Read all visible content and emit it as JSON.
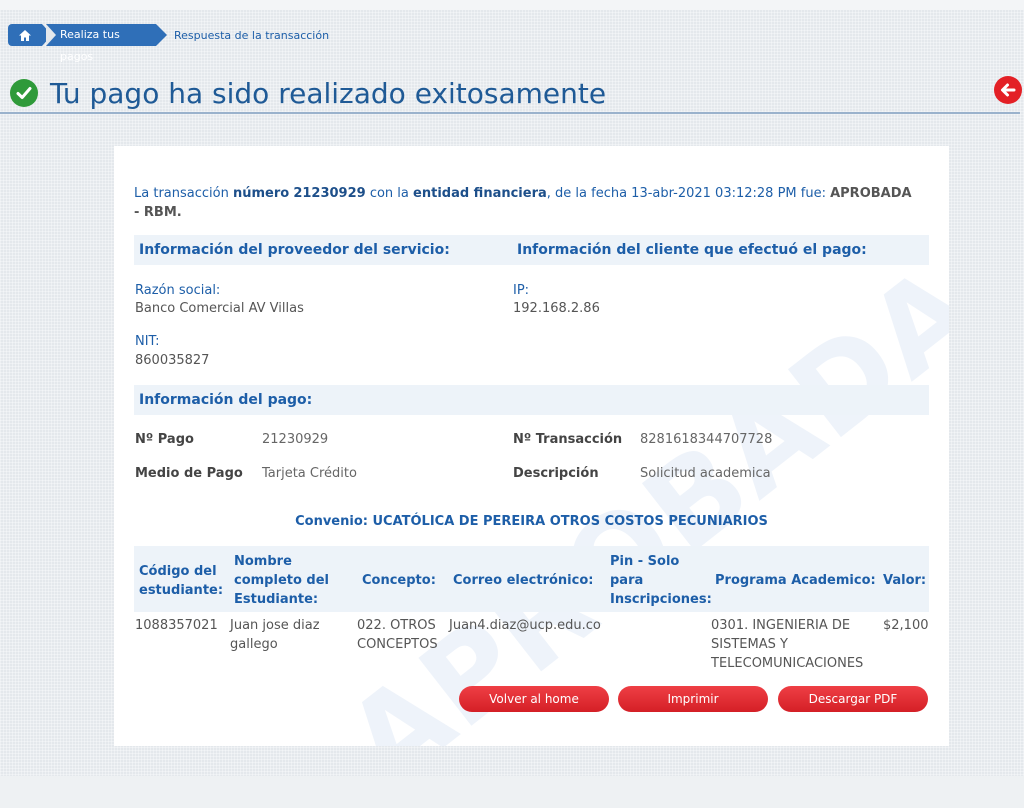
{
  "breadcrumb": {
    "item1": "Realiza tus pagos",
    "item2": "Respuesta de la transacción"
  },
  "header": {
    "title": "Tu pago ha sido realizado exitosamente"
  },
  "watermark": "APROBADA",
  "transaction": {
    "part1": "La transacción ",
    "numero_label": "número",
    "numero": "21230929",
    "part2": " con la ",
    "entidad_label": "entidad financiera",
    "part3": ", de la fecha 13-abr-2021 03:12:28 PM fue: ",
    "status": "APROBADA - RBM."
  },
  "provider": {
    "section_title": "Información del proveedor del servicio:",
    "razon_label": "Razón social:",
    "razon_value": "Banco Comercial AV Villas",
    "nit_label": "NIT:",
    "nit_value": "860035827"
  },
  "client": {
    "section_title": "Información del cliente que efectuó el pago:",
    "ip_label": "IP:",
    "ip_value": "192.168.2.86"
  },
  "payment": {
    "section_title": "Información del pago:",
    "pago_label": "Nº Pago",
    "pago_value": "21230929",
    "transaccion_label": "Nº Transacción",
    "transaccion_value": "8281618344707728",
    "medio_label": "Medio de Pago",
    "medio_value": "Tarjeta Crédito",
    "descripcion_label": "Descripción",
    "descripcion_value": "Solicitud academica"
  },
  "convenio": "Convenio: UCATÓLICA DE PEREIRA OTROS COSTOS PECUNIARIOS",
  "table": {
    "headers": {
      "codigo": [
        "Código del",
        "estudiante:"
      ],
      "nombre": [
        "Nombre",
        "completo del",
        "Estudiante:"
      ],
      "concepto": "Concepto:",
      "correo": "Correo electrónico:",
      "pin": [
        "Pin - Solo",
        "para",
        "Inscripciones:"
      ],
      "programa": "Programa Academico:",
      "valor": "Valor:"
    },
    "row": {
      "codigo": "1088357021",
      "nombre": [
        "Juan jose diaz",
        "gallego"
      ],
      "concepto": [
        "022. OTROS",
        "CONCEPTOS"
      ],
      "correo": "Juan4.diaz@ucp.edu.co",
      "pin": "",
      "programa": [
        "0301. INGENIERIA DE",
        "SISTEMAS Y",
        "TELECOMUNICACIONES"
      ],
      "valor": "$2,100"
    }
  },
  "buttons": {
    "home": "Volver al home",
    "print": "Imprimir",
    "pdf": "Descargar PDF"
  },
  "colors": {
    "primary_blue": "#1d5ea8",
    "success_green": "#2f9a3a",
    "button_red": "#e32026"
  }
}
